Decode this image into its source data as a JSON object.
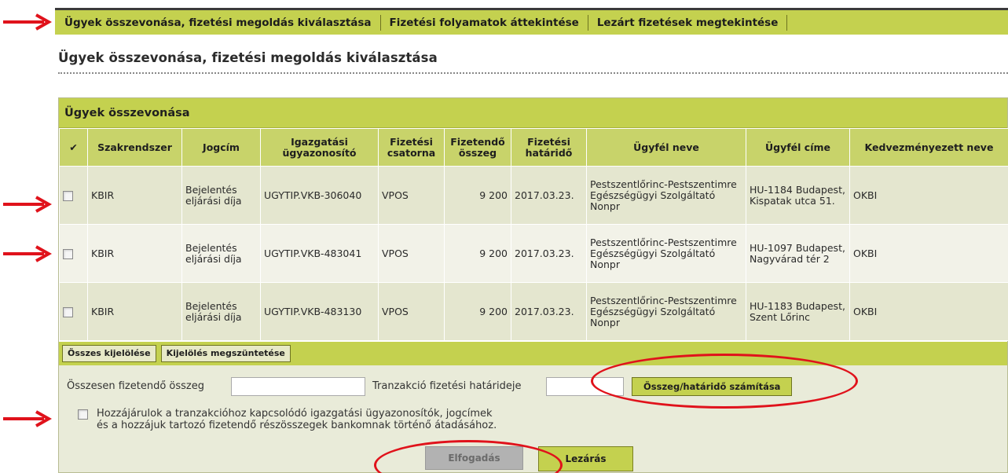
{
  "nav": {
    "tabs": [
      {
        "label": "Ügyek összevonása, fizetési megoldás kiválasztása"
      },
      {
        "label": "Fizetési folyamatok áttekintése"
      },
      {
        "label": "Lezárt fizetések megtekintése"
      }
    ]
  },
  "page_title": "Ügyek összevonása, fizetési megoldás kiválasztása",
  "panel": {
    "title": "Ügyek összevonása",
    "columns": [
      {
        "label": "✔"
      },
      {
        "label": "Szakrendszer"
      },
      {
        "label": "Jogcím"
      },
      {
        "label": "Igazgatási ügyazonosító"
      },
      {
        "label": "Fizetési csatorna"
      },
      {
        "label": "Fizetendő összeg"
      },
      {
        "label": "Fizetési határidő"
      },
      {
        "label": "Ügyfél neve"
      },
      {
        "label": "Ügyfél címe"
      },
      {
        "label": "Kedvezményezett neve"
      }
    ],
    "rows": [
      {
        "system": "KBIR",
        "title": "Bejelentés eljárási díja",
        "case_id": "UGYTIP.VKB-306040",
        "channel": "VPOS",
        "amount": "9 200",
        "deadline": "2017.03.23.",
        "client": "Pestszentlőrinc-Pestszentimre Egészségügyi Szolgáltató Nonpr",
        "address": "HU-1184 Budapest, Kispatak utca 51.",
        "beneficiary": "OKBI"
      },
      {
        "system": "KBIR",
        "title": "Bejelentés eljárási díja",
        "case_id": "UGYTIP.VKB-483041",
        "channel": "VPOS",
        "amount": "9 200",
        "deadline": "2017.03.23.",
        "client": "Pestszentlőrinc-Pestszentimre Egészségügyi Szolgáltató Nonpr",
        "address": "HU-1097 Budapest, Nagyvárad tér 2",
        "beneficiary": "OKBI"
      },
      {
        "system": "KBIR",
        "title": "Bejelentés eljárási díja",
        "case_id": "UGYTIP.VKB-483130",
        "channel": "VPOS",
        "amount": "9 200",
        "deadline": "2017.03.23.",
        "client": "Pestszentlőrinc-Pestszentimre Egészségügyi Szolgáltató Nonpr",
        "address": "HU-1183 Budapest, Szent Lőrinc",
        "beneficiary": "OKBI"
      }
    ],
    "select_all_label": "Összes kijelölése",
    "clear_selection_label": "Kijelölés megszüntetése"
  },
  "form": {
    "total_label": "Összesen fizetendő összeg",
    "total_value": "",
    "deadline_label": "Tranzakció fizetési határideje",
    "deadline_value": "",
    "calc_button": "Összeg/határidő számítása",
    "consent_line1": "Hozzájárulok a tranzakcióhoz kapcsolódó igazgatási ügyazonosítók, jogcímek",
    "consent_line2": "és a hozzájuk tartozó fizetendő részösszegek bankomnak történő átadásához.",
    "accept_button": "Elfogadás",
    "close_button": "Lezárás"
  },
  "annotation_color": "#e0121b"
}
